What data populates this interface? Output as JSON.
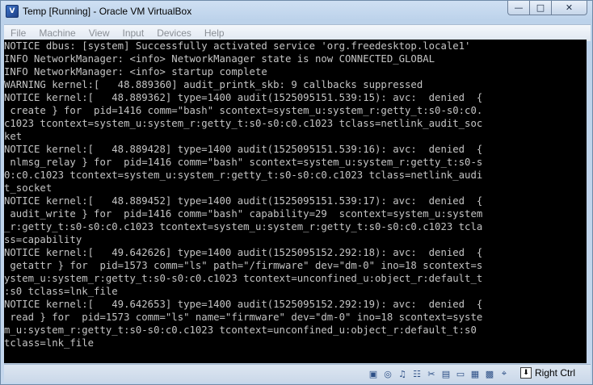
{
  "window": {
    "title": "Temp [Running] - Oracle VM VirtualBox",
    "controls": {
      "minimize": "—",
      "maximize": "□",
      "close": "✕"
    }
  },
  "menubar": {
    "items": [
      "File",
      "Machine",
      "View",
      "Input",
      "Devices",
      "Help"
    ]
  },
  "console": {
    "lines": [
      "NOTICE dbus: [system] Successfully activated service 'org.freedesktop.locale1'",
      "INFO NetworkManager: <info> NetworkManager state is now CONNECTED_GLOBAL",
      "INFO NetworkManager: <info> startup complete",
      "WARNING kernel:[   48.889360] audit_printk_skb: 9 callbacks suppressed",
      "NOTICE kernel:[   48.889362] type=1400 audit(1525095151.539:15): avc:  denied  {",
      " create } for  pid=1416 comm=\"bash\" scontext=system_u:system_r:getty_t:s0-s0:c0.",
      "c1023 tcontext=system_u:system_r:getty_t:s0-s0:c0.c1023 tclass=netlink_audit_soc",
      "ket",
      "NOTICE kernel:[   48.889428] type=1400 audit(1525095151.539:16): avc:  denied  {",
      " nlmsg_relay } for  pid=1416 comm=\"bash\" scontext=system_u:system_r:getty_t:s0-s",
      "0:c0.c1023 tcontext=system_u:system_r:getty_t:s0-s0:c0.c1023 tclass=netlink_audi",
      "t_socket",
      "NOTICE kernel:[   48.889452] type=1400 audit(1525095151.539:17): avc:  denied  {",
      " audit_write } for  pid=1416 comm=\"bash\" capability=29  scontext=system_u:system",
      "_r:getty_t:s0-s0:c0.c1023 tcontext=system_u:system_r:getty_t:s0-s0:c0.c1023 tcla",
      "ss=capability",
      "NOTICE kernel:[   49.642626] type=1400 audit(1525095152.292:18): avc:  denied  {",
      " getattr } for  pid=1573 comm=\"ls\" path=\"/firmware\" dev=\"dm-0\" ino=18 scontext=s",
      "ystem_u:system_r:getty_t:s0-s0:c0.c1023 tcontext=unconfined_u:object_r:default_t",
      ":s0 tclass=lnk_file",
      "NOTICE kernel:[   49.642653] type=1400 audit(1525095152.292:19): avc:  denied  {",
      " read } for  pid=1573 comm=\"ls\" name=\"firmware\" dev=\"dm-0\" ino=18 scontext=syste",
      "m_u:system_r:getty_t:s0-s0:c0.c1023 tcontext=unconfined_u:object_r:default_t:s0",
      "tclass=lnk_file"
    ]
  },
  "statusbar": {
    "icons": [
      {
        "name": "hard-disk-icon",
        "glyph": "▣"
      },
      {
        "name": "optical-drive-icon",
        "glyph": "◎"
      },
      {
        "name": "audio-icon",
        "glyph": "♫"
      },
      {
        "name": "network-icon",
        "glyph": "☷"
      },
      {
        "name": "usb-icon",
        "glyph": "✂"
      },
      {
        "name": "shared-folders-icon",
        "glyph": "▤"
      },
      {
        "name": "display-icon",
        "glyph": "▭"
      },
      {
        "name": "video-capture-icon",
        "glyph": "▦"
      },
      {
        "name": "cpu-icon",
        "glyph": "▩"
      },
      {
        "name": "mouse-integration-icon",
        "glyph": "⌖"
      }
    ],
    "host_key_label": "Right Ctrl",
    "host_key_arrow": "⬇"
  }
}
